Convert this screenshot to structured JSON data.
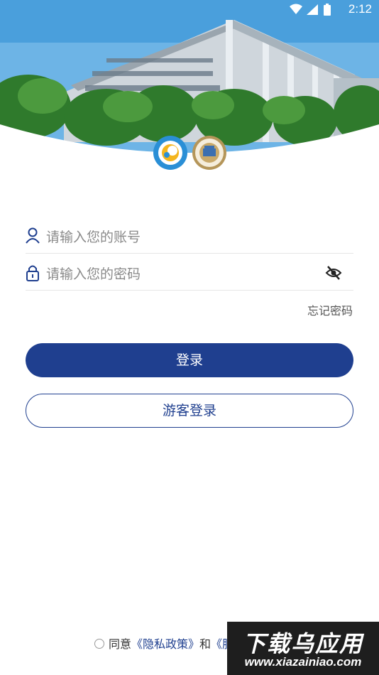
{
  "status_bar": {
    "time": "2:12",
    "icons": [
      "wifi-icon",
      "signal-icon",
      "battery-icon"
    ]
  },
  "login": {
    "account_placeholder": "请输入您的账号",
    "password_placeholder": "请输入您的密码",
    "forgot_password": "忘记密码",
    "login_button": "登录",
    "guest_button": "游客登录"
  },
  "agreement": {
    "prefix": "同意",
    "privacy_link": "《隐私政策》",
    "and": "和",
    "service_link": "《服务协"
  },
  "watermark": {
    "title": "下载乌应用",
    "url": "www.xiazainiao.com"
  },
  "colors": {
    "primary": "#1f3f8f",
    "placeholder": "#8a8a8a"
  }
}
